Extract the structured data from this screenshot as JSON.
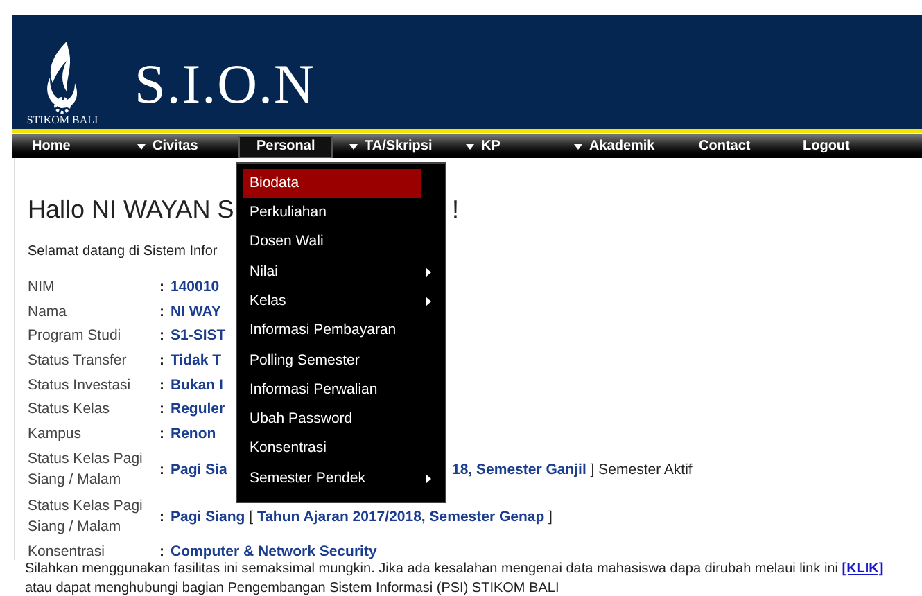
{
  "header": {
    "logo_text": "STIKOM BALI",
    "title": "S.I.O.N"
  },
  "nav": [
    {
      "label": "Home",
      "caret": false,
      "selected": false
    },
    {
      "label": "Civitas",
      "caret": true,
      "selected": false
    },
    {
      "label": "Personal",
      "caret": false,
      "selected": true
    },
    {
      "label": "TA/Skripsi",
      "caret": true,
      "selected": false
    },
    {
      "label": "KP",
      "caret": true,
      "selected": false
    },
    {
      "label": "Akademik",
      "caret": true,
      "selected": false
    },
    {
      "label": "Contact",
      "caret": false,
      "selected": false
    },
    {
      "label": "Logout",
      "caret": false,
      "selected": false
    }
  ],
  "dropdown": [
    {
      "label": "Biodata",
      "selected": true,
      "submenu": false
    },
    {
      "label": "Perkuliahan",
      "selected": false,
      "submenu": false
    },
    {
      "label": "Dosen Wali",
      "selected": false,
      "submenu": false
    },
    {
      "label": "Nilai",
      "selected": false,
      "submenu": true
    },
    {
      "label": "Kelas",
      "selected": false,
      "submenu": true
    },
    {
      "label": "Informasi Pembayaran",
      "selected": false,
      "submenu": false
    },
    {
      "label": "Polling Semester",
      "selected": false,
      "submenu": false
    },
    {
      "label": "Informasi Perwalian",
      "selected": false,
      "submenu": false
    },
    {
      "label": "Ubah Password",
      "selected": false,
      "submenu": false
    },
    {
      "label": "Konsentrasi",
      "selected": false,
      "submenu": false
    },
    {
      "label": "Semester Pendek",
      "selected": false,
      "submenu": true
    }
  ],
  "greeting": {
    "left": "Hallo NI WAYAN S",
    "right": "!"
  },
  "welcome": "Selamat datang di Sistem Infor",
  "rows": [
    {
      "label": "NIM",
      "colon": ":",
      "value": "**140010**"
    },
    {
      "label": "Nama",
      "colon": ":",
      "value": "**NI WAY**"
    },
    {
      "label": "Program Studi",
      "colon": ":",
      "value": "**S1-SIST**"
    },
    {
      "label": "Status Transfer",
      "colon": ":",
      "value": "**Tidak T**"
    },
    {
      "label": "Status Investasi",
      "colon": ":",
      "value": "**Bukan I**"
    },
    {
      "label": "Status Kelas",
      "colon": ":",
      "value": "**Reguler**"
    },
    {
      "label": "Kampus",
      "colon": ":",
      "value": "**Renon**"
    },
    {
      "label": "Status Kelas Pagi Siang / Malam",
      "colon": ":",
      "value": "**Pagi Sia**",
      "value_right": "**18, Semester Ganjil** ] Semester Aktif"
    },
    {
      "label": "Status Kelas Pagi Siang / Malam",
      "colon": ":",
      "value": "**Pagi Siang** [ **Tahun Ajaran 2017/2018, Semester Genap** ]"
    },
    {
      "label": "Konsentrasi",
      "colon": ":",
      "value": "**Computer & Network Security**"
    }
  ],
  "footer": {
    "text": "Silahkan menggunakan fasilitas ini semaksimal mungkin. Jika ada kesalahan mengenai data mahasiswa dapa dirubah melaui link ini",
    "link": "[KLIK]",
    "after": "atau dapat menghubungi bagian Pengembangan Sistem Informasi (PSI) STIKOM BALI"
  }
}
